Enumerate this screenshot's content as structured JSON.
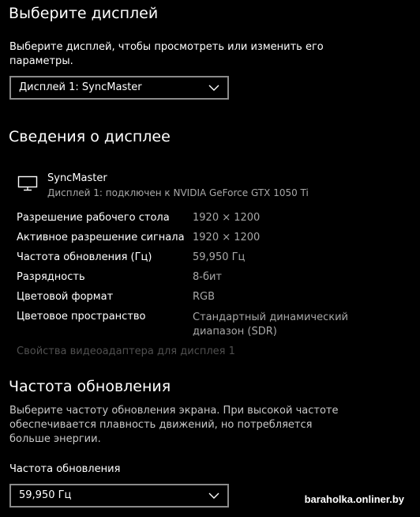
{
  "select_display": {
    "title": "Выберите дисплей",
    "description": "Выберите дисплей, чтобы просмотреть или изменить его параметры.",
    "dropdown_value": "Дисплей 1: SyncMaster",
    "chevron_icon": "chevron-down-icon"
  },
  "display_info": {
    "title": "Сведения о дисплее",
    "monitor_icon": "monitor-icon",
    "monitor_name": "SyncMaster",
    "monitor_subtitle": "Дисплей 1: подключен к NVIDIA GeForce GTX 1050 Ti",
    "rows": [
      {
        "label": "Разрешение рабочего стола",
        "value": "1920 × 1200"
      },
      {
        "label": "Активное разрешение сигнала",
        "value": "1920 × 1200"
      },
      {
        "label": "Частота обновления (Гц)",
        "value": "59,950 Гц"
      },
      {
        "label": "Разрядность",
        "value": "8-бит"
      },
      {
        "label": "Цветовой формат",
        "value": "RGB"
      },
      {
        "label": "Цветовое пространство",
        "value": "Стандартный динамический диапазон (SDR)"
      }
    ],
    "adapter_link": "Свойства видеоадаптера для дисплея 1"
  },
  "refresh_rate": {
    "title": "Частота обновления",
    "description": "Выберите частоту обновления экрана. При высокой частоте обеспечивается плавность движений, но потребляется больше энергии.",
    "field_label": "Частота обновления",
    "dropdown_value": "59,950 Гц",
    "chevron_icon": "chevron-down-icon"
  },
  "watermark": "baraholka.onliner.by",
  "colors": {
    "background": "#000000",
    "text": "#ffffff",
    "secondary_text": "#a8a8a8",
    "disabled_text": "#4f4f4f",
    "dropdown_border": "#8a8a8a"
  }
}
